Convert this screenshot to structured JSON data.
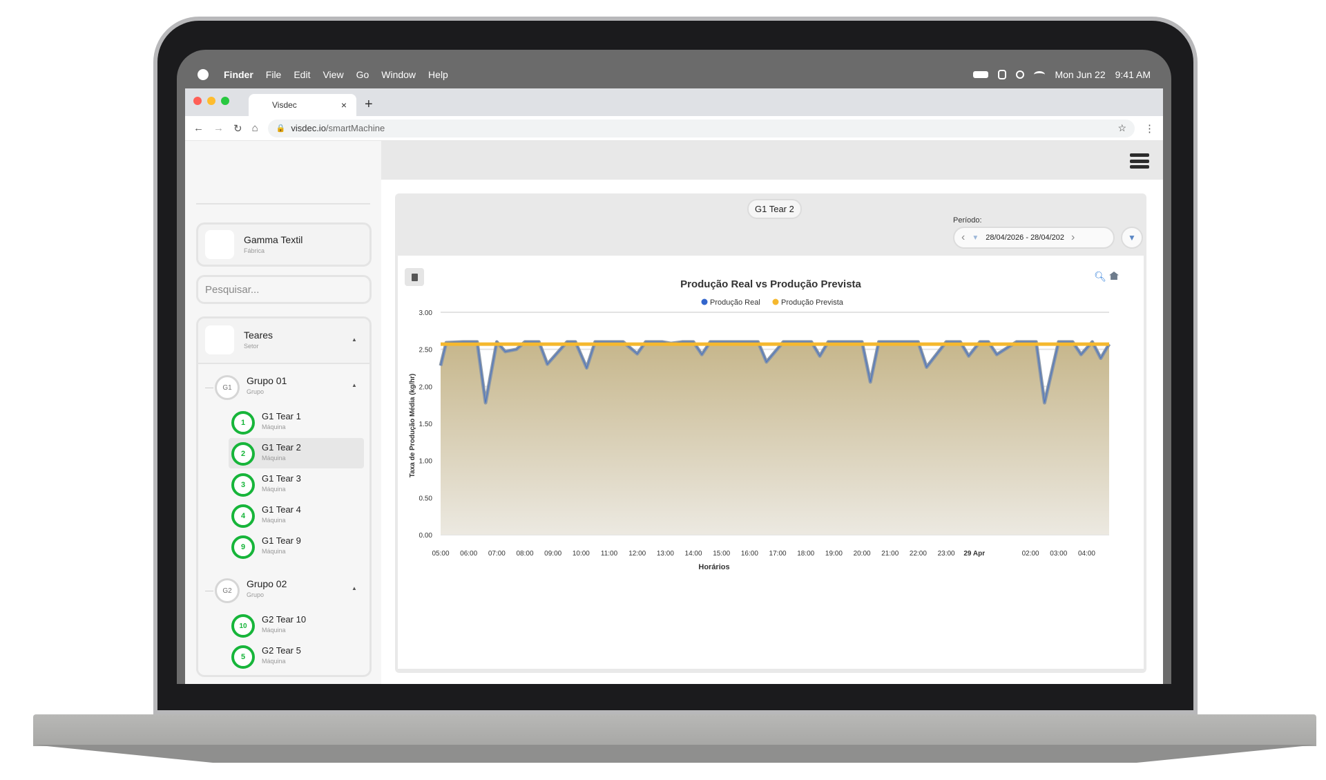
{
  "menubar": {
    "app_name": "Finder",
    "items": [
      "File",
      "Edit",
      "View",
      "Go",
      "Window",
      "Help"
    ],
    "date": "Mon Jun 22",
    "time": "9:41 AM"
  },
  "browser": {
    "tab_title": "Visdec",
    "tab_close": "×",
    "new_tab": "+",
    "url_host": "visdec.io",
    "url_path": "/smartMachine"
  },
  "sidebar": {
    "factory": {
      "name": "Gamma Textil",
      "type": "Fábrica"
    },
    "search_placeholder": "Pesquisar...",
    "sector": {
      "name": "Teares",
      "type": "Setor"
    },
    "groups": [
      {
        "badge": "G1",
        "name": "Grupo 01",
        "type": "Grupo",
        "machines": [
          {
            "badge": "1",
            "name": "G1 Tear 1",
            "type": "Máquina",
            "active": false
          },
          {
            "badge": "2",
            "name": "G1 Tear 2",
            "type": "Máquina",
            "active": true
          },
          {
            "badge": "3",
            "name": "G1 Tear 3",
            "type": "Máquina",
            "active": false
          },
          {
            "badge": "4",
            "name": "G1 Tear 4",
            "type": "Máquina",
            "active": false
          },
          {
            "badge": "9",
            "name": "G1 Tear 9",
            "type": "Máquina",
            "active": false
          }
        ]
      },
      {
        "badge": "G2",
        "name": "Grupo 02",
        "type": "Grupo",
        "machines": [
          {
            "badge": "10",
            "name": "G2 Tear 10",
            "type": "Máquina",
            "active": false
          },
          {
            "badge": "5",
            "name": "G2 Tear 5",
            "type": "Máquina",
            "active": false
          }
        ]
      }
    ]
  },
  "panel": {
    "selected_machine": "G1 Tear 2",
    "periodo_label": "Período:",
    "date_range": "28/04/2026 - 28/04/202"
  },
  "colors": {
    "real": "#3366cc",
    "prevista": "#f5b82e",
    "area": "#c9bb94",
    "grey_line": "#8896a8",
    "machine_green": "#17b53a"
  },
  "chart_data": {
    "type": "area",
    "title": "Produção Real vs Produção Prevista",
    "xlabel": "Horários",
    "ylabel": "Taxa de Produção Média (kg/hr)",
    "ylim": [
      0,
      3
    ],
    "yticks": [
      "0.00",
      "0.50",
      "1.00",
      "1.50",
      "2.00",
      "2.50",
      "3.00"
    ],
    "xticks": [
      "05:00",
      "06:00",
      "07:00",
      "08:00",
      "09:00",
      "10:00",
      "11:00",
      "12:00",
      "13:00",
      "14:00",
      "15:00",
      "16:00",
      "17:00",
      "18:00",
      "19:00",
      "20:00",
      "21:00",
      "22:00",
      "23:00",
      "29 Apr",
      "02:00",
      "03:00",
      "04:00"
    ],
    "x_start_hour": 5,
    "x_end_hour": 28.8,
    "legend": [
      "Produção Real",
      "Produção Prevista"
    ],
    "legend_position": "top-center",
    "grid": true,
    "series": [
      {
        "name": "Produção Prevista",
        "values": [
          2.57
        ]
      },
      {
        "name": "Produção Real",
        "x": [
          5.0,
          5.2,
          5.8,
          6.3,
          6.6,
          7.0,
          7.3,
          7.7,
          8.0,
          8.5,
          8.8,
          9.5,
          9.8,
          10.2,
          10.5,
          11.5,
          12.0,
          12.3,
          12.9,
          13.2,
          13.6,
          14.0,
          14.3,
          14.6,
          15.2,
          16.0,
          16.3,
          16.6,
          17.2,
          18.0,
          18.2,
          18.5,
          18.8,
          19.5,
          19.9,
          20.0,
          20.3,
          20.6,
          21.7,
          22.0,
          22.3,
          23.0,
          23.2,
          23.5,
          23.8,
          24.2,
          24.5,
          24.8,
          25.5,
          25.8,
          26.2,
          26.5,
          27.0,
          27.5,
          27.8,
          28.2,
          28.5,
          28.8
        ],
        "y": [
          2.28,
          2.59,
          2.6,
          2.6,
          1.78,
          2.6,
          2.47,
          2.5,
          2.6,
          2.6,
          2.3,
          2.6,
          2.6,
          2.25,
          2.6,
          2.6,
          2.44,
          2.6,
          2.6,
          2.58,
          2.6,
          2.6,
          2.43,
          2.6,
          2.6,
          2.6,
          2.6,
          2.33,
          2.6,
          2.6,
          2.6,
          2.41,
          2.6,
          2.6,
          2.6,
          2.6,
          2.06,
          2.6,
          2.6,
          2.6,
          2.26,
          2.6,
          2.6,
          2.6,
          2.41,
          2.6,
          2.6,
          2.43,
          2.6,
          2.6,
          2.6,
          1.78,
          2.6,
          2.6,
          2.43,
          2.6,
          2.38,
          2.57
        ]
      }
    ]
  }
}
